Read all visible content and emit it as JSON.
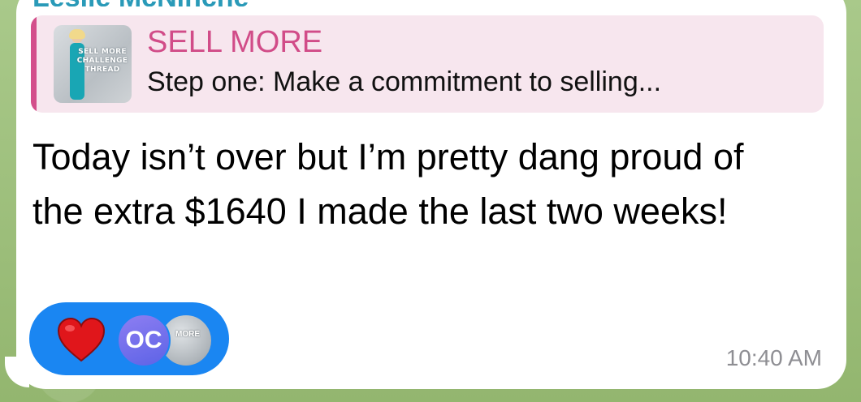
{
  "chat": {
    "sender_name": "Lesile McNinche"
  },
  "reply": {
    "title": "SELL MORE",
    "text": "Step one: Make a commitment to selling...",
    "thumbnail_text": "SELL MORE CHALLENGE THREAD"
  },
  "message": {
    "text": "Today isn’t over but I’m pretty dang proud of the extra $1640 I made the last two weeks!",
    "time": "10:40 AM"
  },
  "reactions": {
    "emoji": "heart",
    "avatar_initials": "OC",
    "avatar_more_text": "MORE"
  },
  "colors": {
    "reply_accent": "#d34f8b",
    "reaction_pill": "#1a86f2",
    "sender_name": "#2a9ab8"
  }
}
